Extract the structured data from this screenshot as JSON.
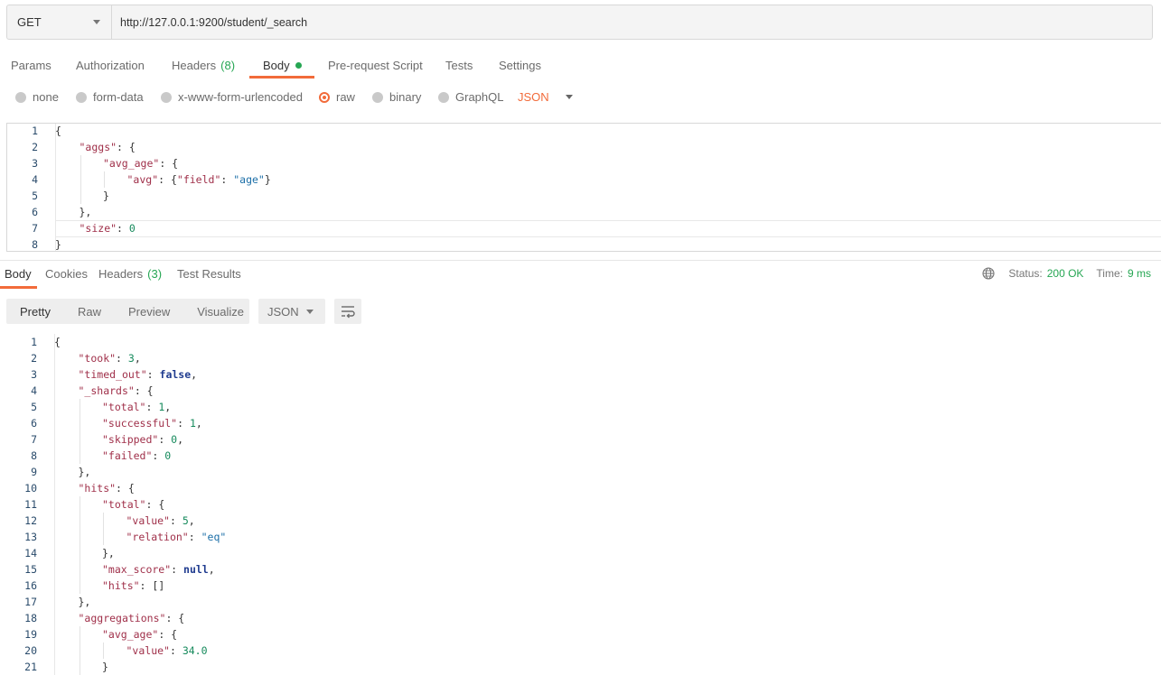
{
  "request": {
    "method": "GET",
    "url": "http://127.0.0.1:9200/student/_search"
  },
  "request_tabs": [
    {
      "label": "Params"
    },
    {
      "label": "Authorization"
    },
    {
      "label": "Headers",
      "count": "(8)"
    },
    {
      "label": "Body",
      "active": true,
      "indicator": "green-dot"
    },
    {
      "label": "Pre-request Script"
    },
    {
      "label": "Tests"
    },
    {
      "label": "Settings"
    }
  ],
  "body_types": [
    {
      "label": "none"
    },
    {
      "label": "form-data"
    },
    {
      "label": "x-www-form-urlencoded"
    },
    {
      "label": "raw",
      "selected": true
    },
    {
      "label": "binary"
    },
    {
      "label": "GraphQL"
    }
  ],
  "body_language": "JSON",
  "request_body": [
    {
      "n": "1",
      "indent": 0,
      "tokens": [
        [
          "p",
          "{"
        ]
      ]
    },
    {
      "n": "2",
      "indent": 1,
      "tokens": [
        [
          "k",
          "\"aggs\""
        ],
        [
          "p",
          ": {"
        ]
      ]
    },
    {
      "n": "3",
      "indent": 2,
      "tokens": [
        [
          "k",
          "\"avg_age\""
        ],
        [
          "p",
          ": {"
        ]
      ]
    },
    {
      "n": "4",
      "indent": 3,
      "tokens": [
        [
          "k",
          "\"avg\""
        ],
        [
          "p",
          ": {"
        ],
        [
          "k",
          "\"field\""
        ],
        [
          "p",
          ": "
        ],
        [
          "s",
          "\"age\""
        ],
        [
          "p",
          "}"
        ]
      ]
    },
    {
      "n": "5",
      "indent": 2,
      "tokens": [
        [
          "p",
          "}"
        ]
      ]
    },
    {
      "n": "6",
      "indent": 1,
      "tokens": [
        [
          "p",
          "},"
        ]
      ]
    },
    {
      "n": "7",
      "indent": 1,
      "tokens": [
        [
          "k",
          "\"size\""
        ],
        [
          "p",
          ": "
        ],
        [
          "n",
          "0"
        ]
      ]
    },
    {
      "n": "8",
      "indent": 0,
      "tokens": [
        [
          "p",
          "}"
        ]
      ]
    }
  ],
  "response_tabs": [
    {
      "label": "Body",
      "active": true
    },
    {
      "label": "Cookies"
    },
    {
      "label": "Headers",
      "count": "(3)"
    },
    {
      "label": "Test Results"
    }
  ],
  "response_status": {
    "status_label": "Status:",
    "status_value": "200 OK",
    "time_label": "Time:",
    "time_value": "9 ms",
    "icon": "globe-icon"
  },
  "view_modes": [
    {
      "label": "Pretty",
      "active": true
    },
    {
      "label": "Raw"
    },
    {
      "label": "Preview"
    },
    {
      "label": "Visualize"
    }
  ],
  "response_format": "JSON",
  "wrap_icon": "wrap-lines-icon",
  "response_body": [
    {
      "n": "1",
      "indent": 0,
      "tokens": [
        [
          "p",
          "{"
        ]
      ]
    },
    {
      "n": "2",
      "indent": 1,
      "tokens": [
        [
          "k",
          "\"took\""
        ],
        [
          "p",
          ": "
        ],
        [
          "n",
          "3"
        ],
        [
          "p",
          ","
        ]
      ]
    },
    {
      "n": "3",
      "indent": 1,
      "tokens": [
        [
          "k",
          "\"timed_out\""
        ],
        [
          "p",
          ": "
        ],
        [
          "kw",
          "false"
        ],
        [
          "p",
          ","
        ]
      ]
    },
    {
      "n": "4",
      "indent": 1,
      "tokens": [
        [
          "k",
          "\"_shards\""
        ],
        [
          "p",
          ": {"
        ]
      ]
    },
    {
      "n": "5",
      "indent": 2,
      "tokens": [
        [
          "k",
          "\"total\""
        ],
        [
          "p",
          ": "
        ],
        [
          "n",
          "1"
        ],
        [
          "p",
          ","
        ]
      ]
    },
    {
      "n": "6",
      "indent": 2,
      "tokens": [
        [
          "k",
          "\"successful\""
        ],
        [
          "p",
          ": "
        ],
        [
          "n",
          "1"
        ],
        [
          "p",
          ","
        ]
      ]
    },
    {
      "n": "7",
      "indent": 2,
      "tokens": [
        [
          "k",
          "\"skipped\""
        ],
        [
          "p",
          ": "
        ],
        [
          "n",
          "0"
        ],
        [
          "p",
          ","
        ]
      ]
    },
    {
      "n": "8",
      "indent": 2,
      "tokens": [
        [
          "k",
          "\"failed\""
        ],
        [
          "p",
          ": "
        ],
        [
          "n",
          "0"
        ]
      ]
    },
    {
      "n": "9",
      "indent": 1,
      "tokens": [
        [
          "p",
          "},"
        ]
      ]
    },
    {
      "n": "10",
      "indent": 1,
      "tokens": [
        [
          "k",
          "\"hits\""
        ],
        [
          "p",
          ": {"
        ]
      ]
    },
    {
      "n": "11",
      "indent": 2,
      "tokens": [
        [
          "k",
          "\"total\""
        ],
        [
          "p",
          ": {"
        ]
      ]
    },
    {
      "n": "12",
      "indent": 3,
      "tokens": [
        [
          "k",
          "\"value\""
        ],
        [
          "p",
          ": "
        ],
        [
          "n",
          "5"
        ],
        [
          "p",
          ","
        ]
      ]
    },
    {
      "n": "13",
      "indent": 3,
      "tokens": [
        [
          "k",
          "\"relation\""
        ],
        [
          "p",
          ": "
        ],
        [
          "s",
          "\"eq\""
        ]
      ]
    },
    {
      "n": "14",
      "indent": 2,
      "tokens": [
        [
          "p",
          "},"
        ]
      ]
    },
    {
      "n": "15",
      "indent": 2,
      "tokens": [
        [
          "k",
          "\"max_score\""
        ],
        [
          "p",
          ": "
        ],
        [
          "kw",
          "null"
        ],
        [
          "p",
          ","
        ]
      ]
    },
    {
      "n": "16",
      "indent": 2,
      "tokens": [
        [
          "k",
          "\"hits\""
        ],
        [
          "p",
          ": []"
        ]
      ]
    },
    {
      "n": "17",
      "indent": 1,
      "tokens": [
        [
          "p",
          "},"
        ]
      ]
    },
    {
      "n": "18",
      "indent": 1,
      "tokens": [
        [
          "k",
          "\"aggregations\""
        ],
        [
          "p",
          ": {"
        ]
      ]
    },
    {
      "n": "19",
      "indent": 2,
      "tokens": [
        [
          "k",
          "\"avg_age\""
        ],
        [
          "p",
          ": {"
        ]
      ]
    },
    {
      "n": "20",
      "indent": 3,
      "tokens": [
        [
          "k",
          "\"value\""
        ],
        [
          "p",
          ": "
        ],
        [
          "n",
          "34.0"
        ]
      ]
    },
    {
      "n": "21",
      "indent": 2,
      "tokens": [
        [
          "p",
          "}"
        ]
      ]
    }
  ]
}
